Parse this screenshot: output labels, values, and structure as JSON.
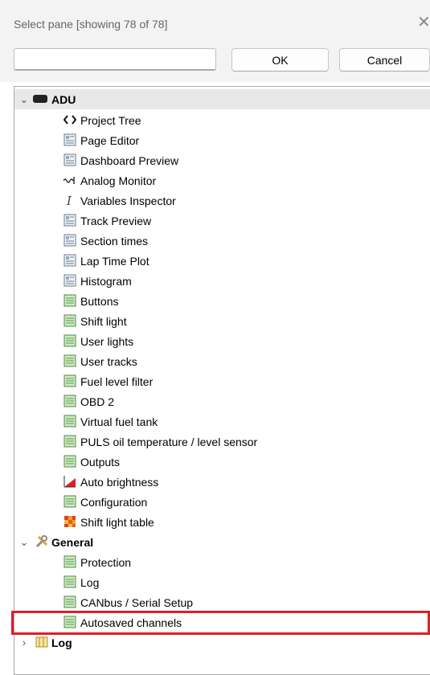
{
  "window": {
    "title": "Select pane [showing 78 of 78]",
    "close_glyph": "✕"
  },
  "filter": {
    "value": "",
    "placeholder": ""
  },
  "buttons": {
    "ok": "OK",
    "cancel": "Cancel"
  },
  "tree": {
    "groups": [
      {
        "label": "ADU",
        "expanded": true,
        "icon": "device-icon"
      },
      {
        "label": "General",
        "expanded": true,
        "icon": "tools-icon"
      },
      {
        "label": "Log",
        "expanded": false,
        "icon": "log-icon"
      }
    ],
    "adu_items": [
      {
        "label": "Project Tree",
        "icon": "code-icon"
      },
      {
        "label": "Page Editor",
        "icon": "page-icon"
      },
      {
        "label": "Dashboard Preview",
        "icon": "page-icon"
      },
      {
        "label": "Analog Monitor",
        "icon": "waveform-icon"
      },
      {
        "label": "Variables Inspector",
        "icon": "cursor-icon"
      },
      {
        "label": "Track Preview",
        "icon": "page-icon"
      },
      {
        "label": "Section times",
        "icon": "page-icon"
      },
      {
        "label": "Lap Time Plot",
        "icon": "page-icon"
      },
      {
        "label": "Histogram",
        "icon": "page-icon"
      },
      {
        "label": "Buttons",
        "icon": "table-icon"
      },
      {
        "label": "Shift light",
        "icon": "table-icon"
      },
      {
        "label": "User lights",
        "icon": "table-icon"
      },
      {
        "label": "User tracks",
        "icon": "table-icon"
      },
      {
        "label": "Fuel level filter",
        "icon": "table-icon"
      },
      {
        "label": "OBD 2",
        "icon": "table-icon"
      },
      {
        "label": "Virtual fuel tank",
        "icon": "table-icon"
      },
      {
        "label": "PULS oil temperature / level sensor",
        "icon": "table-icon"
      },
      {
        "label": "Outputs",
        "icon": "table-icon"
      },
      {
        "label": "Auto brightness",
        "icon": "brightness-chart-icon"
      },
      {
        "label": "Configuration",
        "icon": "table-icon"
      },
      {
        "label": "Shift light table",
        "icon": "color-table-icon"
      }
    ],
    "general_items": [
      {
        "label": "Protection",
        "icon": "table-icon"
      },
      {
        "label": "Log",
        "icon": "table-icon"
      },
      {
        "label": "CANbus / Serial Setup",
        "icon": "table-icon"
      },
      {
        "label": "Autosaved channels",
        "icon": "table-icon",
        "selected": true
      }
    ]
  },
  "colors": {
    "highlight": "#e01e2a",
    "selection": "#e5e5e5"
  }
}
